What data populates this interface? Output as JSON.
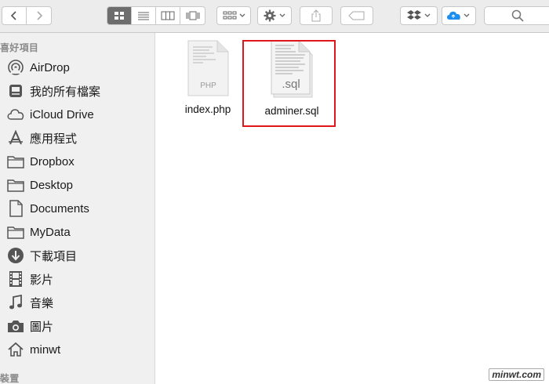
{
  "toolbar": {
    "back_icon": "chevron-left",
    "forward_icon": "chevron-right",
    "view_modes": [
      "icon-view",
      "list-view",
      "column-view",
      "cover-flow-view"
    ],
    "arrange_icon": "arrange-grid",
    "action_icon": "gear",
    "share_icon": "share",
    "tags_icon": "tag",
    "dropbox_icon": "dropbox",
    "icloud_icon": "icloud"
  },
  "search": {
    "label": "搜尋"
  },
  "sidebar": {
    "favorites_header": "喜好項目",
    "items": [
      {
        "label": "AirDrop",
        "icon": "airdrop"
      },
      {
        "label": "我的所有檔案",
        "icon": "all-files"
      },
      {
        "label": "iCloud Drive",
        "icon": "cloud"
      },
      {
        "label": "應用程式",
        "icon": "applications"
      },
      {
        "label": "Dropbox",
        "icon": "folder"
      },
      {
        "label": "Desktop",
        "icon": "folder"
      },
      {
        "label": "Documents",
        "icon": "document"
      },
      {
        "label": "MyData",
        "icon": "folder"
      },
      {
        "label": "下載項目",
        "icon": "download"
      },
      {
        "label": "影片",
        "icon": "film"
      },
      {
        "label": "音樂",
        "icon": "music"
      },
      {
        "label": "圖片",
        "icon": "camera"
      },
      {
        "label": "minwt",
        "icon": "home"
      }
    ],
    "devices_header": "裝置"
  },
  "files": [
    {
      "name": "index.php",
      "badge": "PHP"
    },
    {
      "name": "adminer.sql",
      "badge": ".sql"
    }
  ],
  "watermark": "minwt.com",
  "colors": {
    "highlight": "#e0161b",
    "icloud": "#1c8ef0",
    "sidebar_bg": "#f1f0f1"
  }
}
